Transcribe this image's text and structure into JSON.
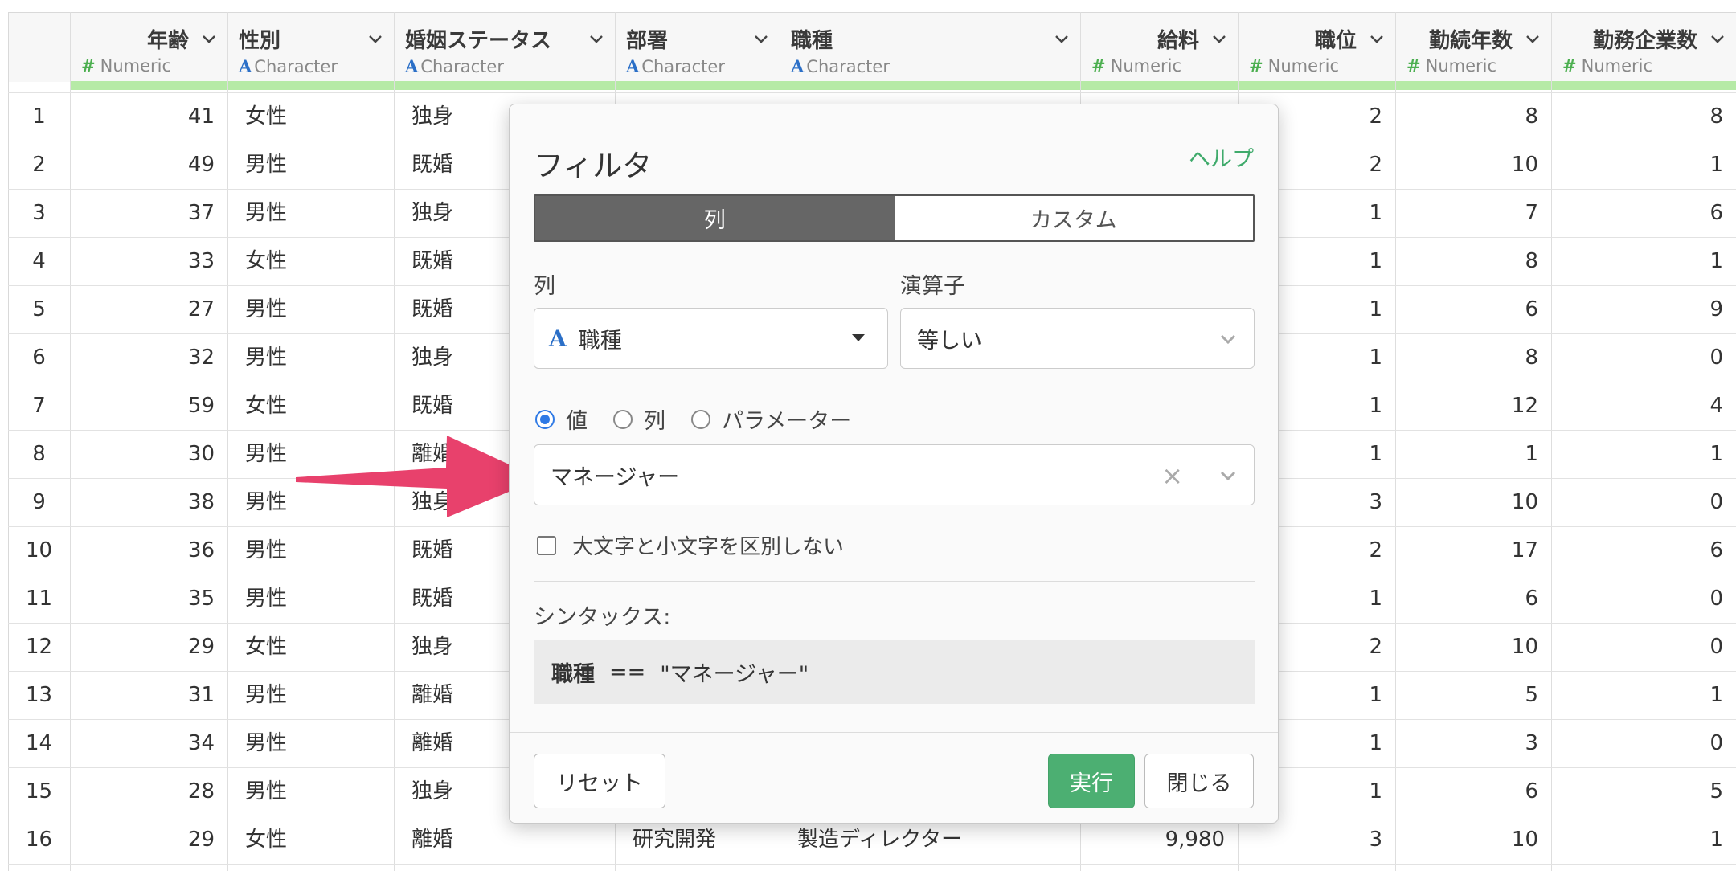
{
  "columns": [
    {
      "name": "年齢",
      "type": "Numeric"
    },
    {
      "name": "性別",
      "type": "Character"
    },
    {
      "name": "婚姻ステータス",
      "type": "Character"
    },
    {
      "name": "部署",
      "type": "Character"
    },
    {
      "name": "職種",
      "type": "Character"
    },
    {
      "name": "給料",
      "type": "Numeric"
    },
    {
      "name": "職位",
      "type": "Numeric"
    },
    {
      "name": "勤続年数",
      "type": "Numeric"
    },
    {
      "name": "勤務企業数",
      "type": "Numeric"
    }
  ],
  "rows": [
    {
      "idx": "1",
      "age": "41",
      "gender": "女性",
      "marital": "独身",
      "level": "2",
      "years": "8",
      "companies": "8"
    },
    {
      "idx": "2",
      "age": "49",
      "gender": "男性",
      "marital": "既婚",
      "level": "2",
      "years": "10",
      "companies": "1"
    },
    {
      "idx": "3",
      "age": "37",
      "gender": "男性",
      "marital": "独身",
      "level": "1",
      "years": "7",
      "companies": "6"
    },
    {
      "idx": "4",
      "age": "33",
      "gender": "女性",
      "marital": "既婚",
      "level": "1",
      "years": "8",
      "companies": "1"
    },
    {
      "idx": "5",
      "age": "27",
      "gender": "男性",
      "marital": "既婚",
      "level": "1",
      "years": "6",
      "companies": "9"
    },
    {
      "idx": "6",
      "age": "32",
      "gender": "男性",
      "marital": "独身",
      "level": "1",
      "years": "8",
      "companies": "0"
    },
    {
      "idx": "7",
      "age": "59",
      "gender": "女性",
      "marital": "既婚",
      "level": "1",
      "years": "12",
      "companies": "4"
    },
    {
      "idx": "8",
      "age": "30",
      "gender": "男性",
      "marital": "離婚",
      "level": "1",
      "years": "1",
      "companies": "1"
    },
    {
      "idx": "9",
      "age": "38",
      "gender": "男性",
      "marital": "独身",
      "level": "3",
      "years": "10",
      "companies": "0"
    },
    {
      "idx": "10",
      "age": "36",
      "gender": "男性",
      "marital": "既婚",
      "level": "2",
      "years": "17",
      "companies": "6"
    },
    {
      "idx": "11",
      "age": "35",
      "gender": "男性",
      "marital": "既婚",
      "level": "1",
      "years": "6",
      "companies": "0"
    },
    {
      "idx": "12",
      "age": "29",
      "gender": "女性",
      "marital": "独身",
      "level": "2",
      "years": "10",
      "companies": "0"
    },
    {
      "idx": "13",
      "age": "31",
      "gender": "男性",
      "marital": "離婚",
      "level": "1",
      "years": "5",
      "companies": "1"
    },
    {
      "idx": "14",
      "age": "34",
      "gender": "男性",
      "marital": "離婚",
      "level": "1",
      "years": "3",
      "companies": "0"
    },
    {
      "idx": "15",
      "age": "28",
      "gender": "男性",
      "marital": "独身",
      "level": "1",
      "years": "6",
      "companies": "5"
    },
    {
      "idx": "16",
      "age": "29",
      "gender": "女性",
      "marital": "離婚",
      "dept": "研究開発",
      "job": "製造ディレクター",
      "salary": "9,980",
      "level": "3",
      "years": "10",
      "companies": "1"
    }
  ],
  "dialog": {
    "title": "フィルタ",
    "help": "ヘルプ",
    "tabs": [
      "列",
      "カスタム"
    ],
    "column_label": "列",
    "column_icon": "A",
    "column_value": "職種",
    "operator_label": "演算子",
    "operator_value": "等しい",
    "value_modes": [
      "値",
      "列",
      "パラメーター"
    ],
    "value": "マネージャー",
    "ignore_case_label": "大文字と小文字を区別しない",
    "syntax_label": "シンタックス:",
    "syntax": {
      "column": "職種",
      "op": "==",
      "value": "\"マネージャー\""
    },
    "reset": "リセット",
    "run": "実行",
    "close": "閉じる"
  },
  "colors": {
    "accent_green": "#4caf72",
    "numeric_icon": "#4caf50",
    "character_icon": "#2b6fc7",
    "arrow": "#e8416c",
    "radio_blue": "#2f7ae5"
  }
}
